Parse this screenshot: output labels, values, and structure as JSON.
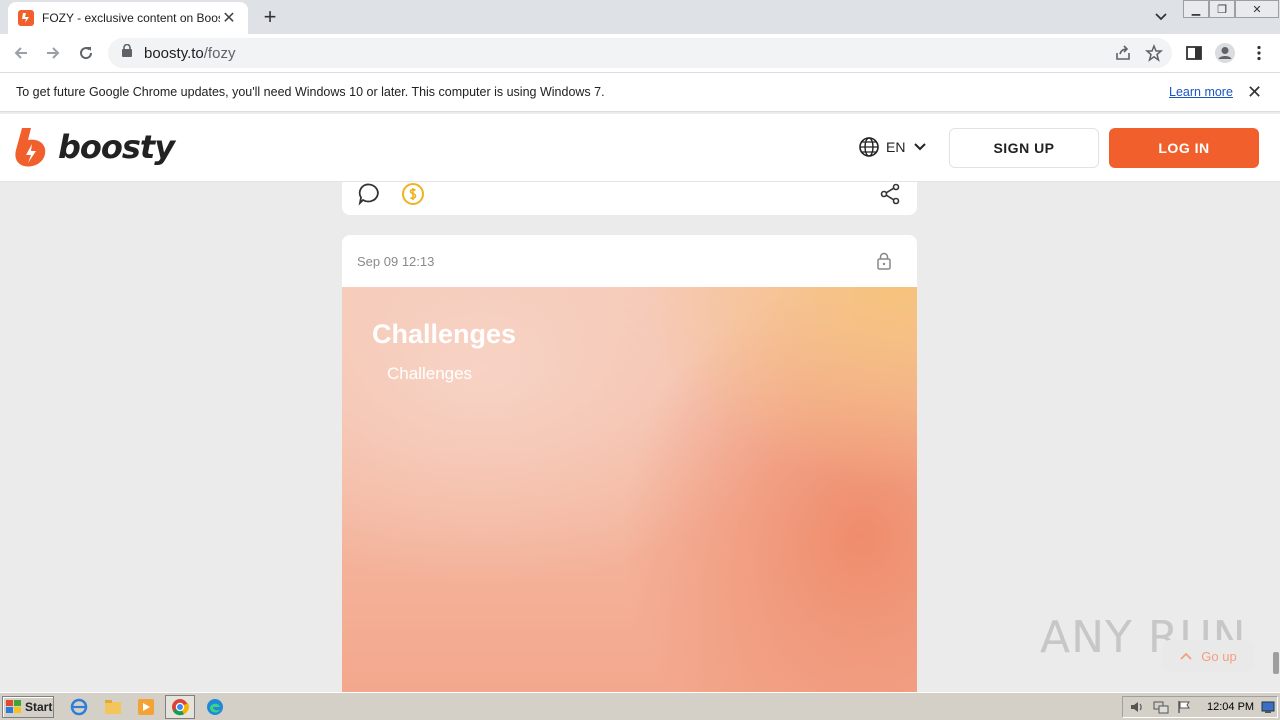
{
  "browser": {
    "tab_title": "FOZY - exclusive content on Boosty",
    "url_host": "boosty.to",
    "url_path": "/fozy",
    "window_controls": [
      "minimize",
      "restore",
      "close"
    ]
  },
  "infobar": {
    "message": "To get future Google Chrome updates, you'll need Windows 10 or later. This computer is using Windows 7.",
    "link": "Learn more"
  },
  "site": {
    "logo_text": "boosty",
    "lang": "EN",
    "signup": "SIGN UP",
    "login": "LOG IN",
    "accent_color": "#f15f2c"
  },
  "post": {
    "date": "Sep 09 12:13",
    "cover_title": "Challenges",
    "cover_subtitle": "Challenges"
  },
  "floating": {
    "go_up": "Go up",
    "watermark": "ANY RUN"
  },
  "taskbar": {
    "start": "Start",
    "clock": "12:04 PM"
  }
}
